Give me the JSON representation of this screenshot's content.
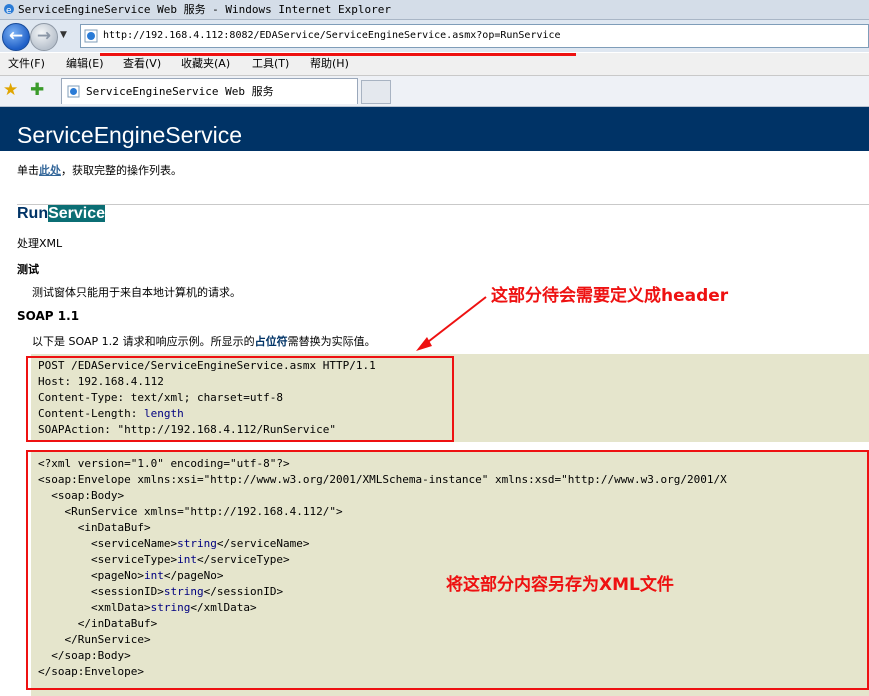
{
  "window": {
    "title": "ServiceEngineService Web 服务 - Windows Internet Explorer"
  },
  "address_bar": {
    "url": "http://192.168.4.112:8082/EDAService/ServiceEngineService.asmx?op=RunService"
  },
  "menu": {
    "items": [
      "文件(F)",
      "编辑(E)",
      "查看(V)",
      "收藏夹(A)",
      "工具(T)",
      "帮助(H)"
    ]
  },
  "tab": {
    "label": "ServiceEngineService Web 服务"
  },
  "page": {
    "header": "ServiceEngineService",
    "intro_prefix": "单击",
    "intro_link": "此处",
    "intro_suffix": "，获取完整的操作列表。",
    "op_name_a": "Run",
    "op_name_b": "Service",
    "op_desc": "处理XML",
    "test_heading": "测试",
    "test_text": "测试窗体只能用于来自本地计算机的请求。",
    "soap_heading": "SOAP 1.1",
    "soap_text_prefix": "以下是  SOAP 1.2 请求和响应示例。所显示的",
    "soap_text_bold": "占位符",
    "soap_text_suffix": "需替换为实际值。",
    "request_lines": [
      "POST /EDAService/ServiceEngineService.asmx HTTP/1.1",
      "Host: 192.168.4.112",
      "Content-Type: text/xml; charset=utf-8",
      "Content-Length: ",
      "SOAPAction: \"http://192.168.4.112/RunService\""
    ],
    "content_length_placeholder": "length",
    "xml_lines": [
      "<?xml version=\"1.0\" encoding=\"utf-8\"?>",
      "<soap:Envelope xmlns:xsi=\"http://www.w3.org/2001/XMLSchema-instance\" xmlns:xsd=\"http://www.w3.org/2001/X",
      "  <soap:Body>",
      "    <RunService xmlns=\"http://192.168.4.112/\">",
      "      <inDataBuf>",
      "        <serviceName>",
      "        <serviceType>",
      "        <pageNo>",
      "        <sessionID>",
      "        <xmlData>",
      "      </inDataBuf>",
      "    </RunService>",
      "  </soap:Body>",
      "</soap:Envelope>"
    ],
    "xml_fields": [
      {
        "type": "string",
        "close": "</serviceName>"
      },
      {
        "type": "int",
        "close": "</serviceType>"
      },
      {
        "type": "int",
        "close": "</pageNo>"
      },
      {
        "type": "string",
        "close": "</sessionID>"
      },
      {
        "type": "string",
        "close": "</xmlData>"
      }
    ]
  },
  "annotations": {
    "header_note": "这部分待会需要定义成header",
    "xml_note": "将这部分内容另存为XML文件"
  },
  "colors": {
    "header_bg": "#003366",
    "annotation_red": "#e11111",
    "code_bg": "#e5e5cc"
  }
}
